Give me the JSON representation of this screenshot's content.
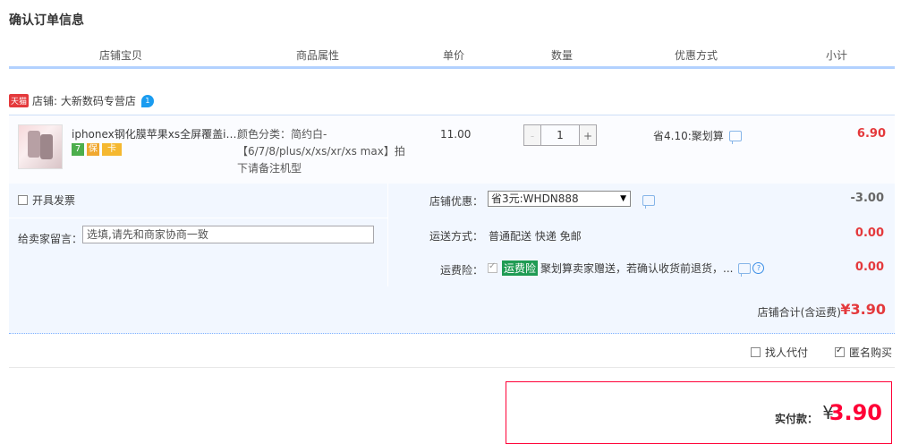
{
  "page_title": "确认订单信息",
  "columns": [
    "店铺宝贝",
    "商品属性",
    "单价",
    "数量",
    "优惠方式",
    "小计"
  ],
  "shop": {
    "badge": "天猫",
    "label": "店铺: 大新数码专营店",
    "ww_badge": "1"
  },
  "item": {
    "title": "iphonex钢化膜苹果xs全屏覆盖iP...",
    "service_icons": [
      "7",
      "保",
      "卡"
    ],
    "sku": "颜色分类：简约白-【6/7/8/plus/x/xs/xr/xs max】拍下请备注机型",
    "unit_price": "11.00",
    "qty_minus": "-",
    "quantity": "1",
    "qty_plus": "+",
    "discount": "省4.10:聚划算",
    "subtotal": "6.90"
  },
  "options": {
    "invoice_label": "开具发票",
    "message_label": "给卖家留言：",
    "message_placeholder": "选填,请先和商家协商一致",
    "coupon_label": "店铺优惠：",
    "coupon_selected": "省3元:WHDN888",
    "coupon_value": "-3.00",
    "shipping_label": "运送方式：",
    "shipping_value": "普通配送 快递 免邮",
    "shipping_fee": "0.00",
    "insurance_label": "运费险：",
    "insurance_tag": "运费险",
    "insurance_text": "聚划算卖家赠送，若确认收货前退货，...",
    "insurance_fee": "0.00"
  },
  "shop_total": {
    "label": "店铺合计(含运费)",
    "value": "¥3.90"
  },
  "extras": {
    "proxy_pay": "找人代付",
    "anonymous": "匿名购买"
  },
  "payment": {
    "label": "实付款：",
    "currency": "¥",
    "value": "3.90"
  },
  "colors": {
    "accent_red": "#e4393c",
    "pay_red": "#ff0036",
    "header_line": "#b2d1ff",
    "panel_bg": "#f2f7ff"
  }
}
